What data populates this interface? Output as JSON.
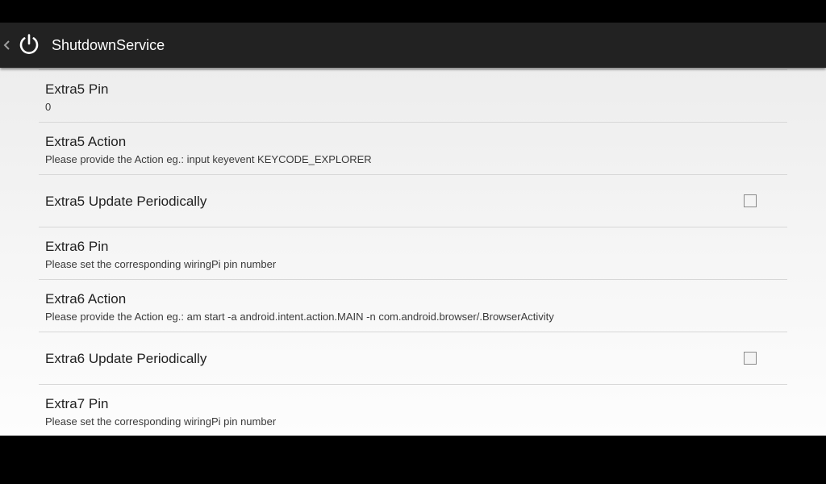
{
  "app": {
    "title": "ShutdownService",
    "up_icon": "chevron-left-icon",
    "app_icon": "power-icon"
  },
  "preferences": [
    {
      "title": "Extra5 Pin",
      "summary": "0",
      "checkbox": false
    },
    {
      "title": "Extra5 Action",
      "summary": "Please provide the Action eg.: input keyevent  KEYCODE_EXPLORER",
      "checkbox": false
    },
    {
      "title": "Extra5 Update Periodically",
      "summary": "",
      "checkbox": true,
      "checked": false
    },
    {
      "title": "Extra6 Pin",
      "summary": "Please set the corresponding wiringPi pin number",
      "checkbox": false
    },
    {
      "title": "Extra6 Action",
      "summary": "Please provide the Action eg.: am start -a android.intent.action.MAIN -n com.android.browser/.BrowserActivity",
      "checkbox": false
    },
    {
      "title": "Extra6 Update Periodically",
      "summary": "",
      "checkbox": true,
      "checked": false
    },
    {
      "title": "Extra7 Pin",
      "summary": "Please set the corresponding wiringPi pin number",
      "checkbox": false
    }
  ],
  "colors": {
    "action_bar": "#222222",
    "content_bg": "#f3f3f3",
    "divider": "#d7d7d7",
    "title_text": "#212121"
  }
}
